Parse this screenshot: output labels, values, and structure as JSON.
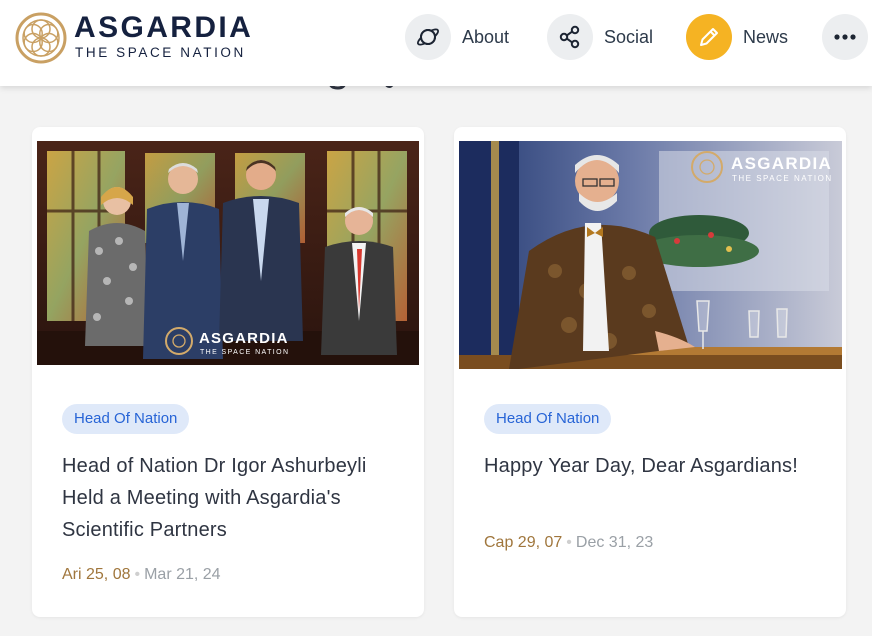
{
  "brand": {
    "title": "ASGARDIA",
    "subtitle": "THE SPACE NATION",
    "accent": "#c9a063",
    "navy": "#15213f"
  },
  "nav": {
    "items": [
      {
        "label": "About",
        "icon": "planet-icon"
      },
      {
        "label": "Social",
        "icon": "share-icon"
      },
      {
        "label": "News",
        "icon": "pencil-icon",
        "active": true,
        "active_color": "#f5b323"
      },
      {
        "label": "",
        "icon": "more-dots-icon"
      }
    ]
  },
  "articles": [
    {
      "image_alt": "Four people posing in front of stained glass windows",
      "image_watermark": {
        "title": "ASGARDIA",
        "subtitle": "THE SPACE NATION"
      },
      "category": "Head Of Nation",
      "title": "Head of Nation Dr Igor Ashurbeyli Held a Meeting with Asgardia's Scientific Partners",
      "asgardian_date": "Ari 25, 08",
      "date": "Mar 21, 24"
    },
    {
      "image_alt": "Man in a velvet jacket seated at a festive table",
      "image_watermark": {
        "title": "ASGARDIA",
        "subtitle": "THE SPACE NATION"
      },
      "category": "Head Of Nation",
      "title": "Happy Year Day, Dear Asgardians!",
      "asgardian_date": "Cap 29, 07",
      "date": "Dec 31, 23"
    }
  ]
}
